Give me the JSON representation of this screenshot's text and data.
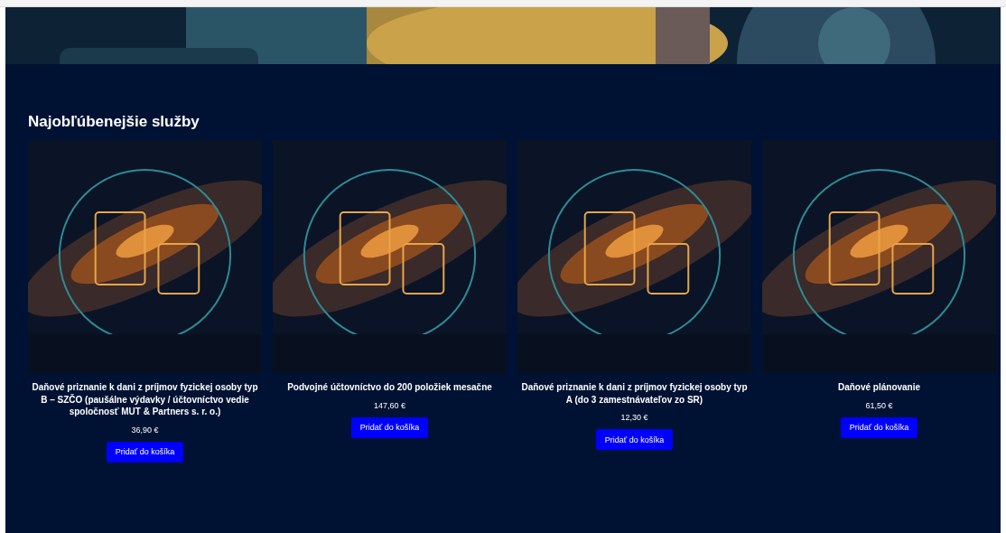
{
  "section": {
    "heading": "Najobľúbenejšie služby",
    "products": [
      {
        "title": "Daňové priznanie k dani z príjmov fyzickej osoby typ B – SZČO (paušálne výdavky / účtovníctvo vedie spoločnosť MUT & Partners s. r. o.)",
        "price": "36,90 €",
        "button": "Pridať do košíka"
      },
      {
        "title": "Podvojné účtovníctvo do 200 položiek mesačne",
        "price": "147,60 €",
        "button": "Pridať do košíka"
      },
      {
        "title": "Daňové priznanie k dani z príjmov fyzickej osoby typ A (do 3 zamestnávateľov zo SR)",
        "price": "12,30 €",
        "button": "Pridať do košíka"
      },
      {
        "title": "Daňové plánovanie",
        "price": "61,50 €",
        "button": "Pridať do košíka"
      }
    ]
  }
}
